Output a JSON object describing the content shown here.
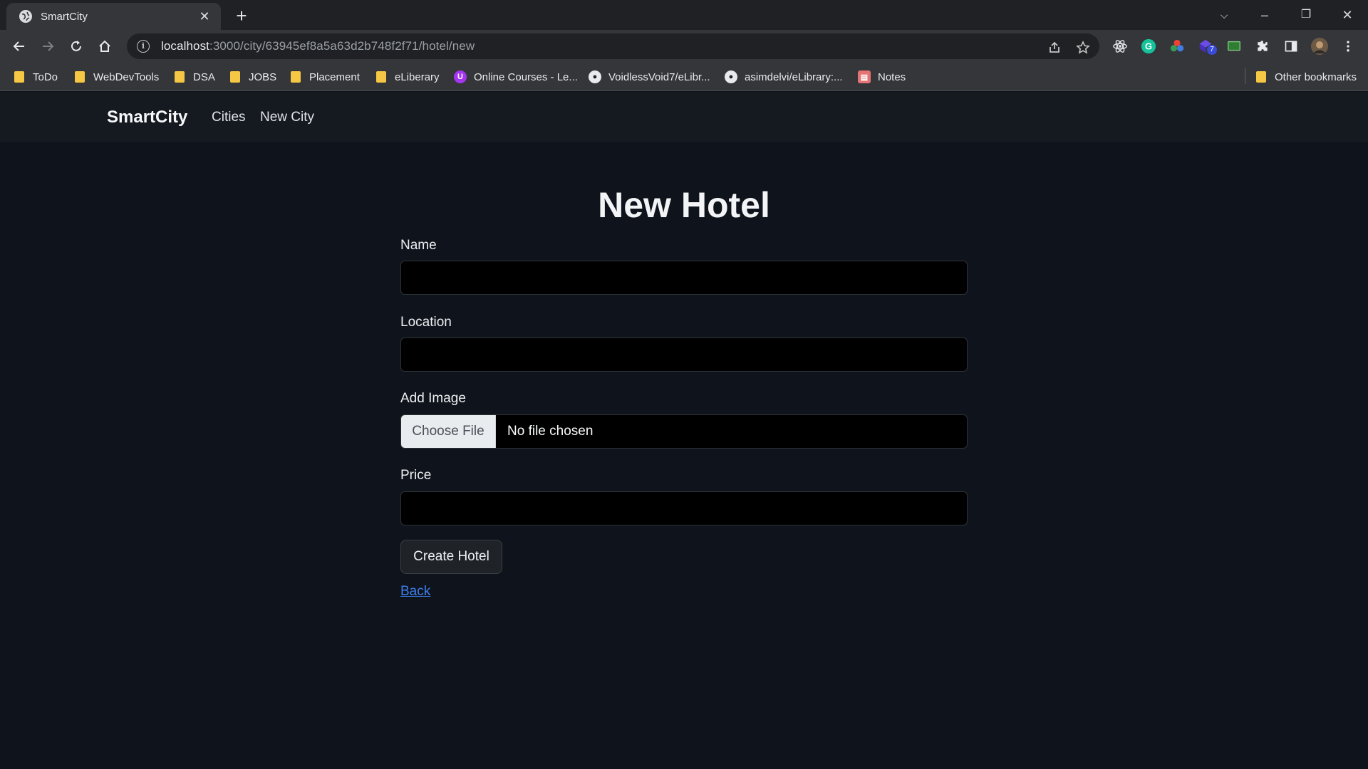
{
  "browser": {
    "tab_title": "SmartCity",
    "url_host": "localhost",
    "url_path": ":3000/city/63945ef8a5a63d2b748f2f71/hotel/new",
    "bookmarks": [
      {
        "label": "ToDo",
        "icon": "folder-icon"
      },
      {
        "label": "WebDevTools",
        "icon": "folder-icon"
      },
      {
        "label": "DSA",
        "icon": "folder-icon"
      },
      {
        "label": "JOBS",
        "icon": "folder-icon"
      },
      {
        "label": "Placement",
        "icon": "folder-icon"
      },
      {
        "label": "eLiberary",
        "icon": "folder-icon"
      },
      {
        "label": "Online Courses - Le...",
        "icon": "udemy-icon"
      },
      {
        "label": "VoidlessVoid7/eLibr...",
        "icon": "github-icon"
      },
      {
        "label": "asimdelvi/eLibrary:...",
        "icon": "github-icon"
      },
      {
        "label": "Notes",
        "icon": "notes-icon"
      }
    ],
    "other_bookmarks": "Other bookmarks",
    "extension_badge": "7"
  },
  "navbar": {
    "brand": "SmartCity",
    "links": [
      "Cities",
      "New City"
    ]
  },
  "form": {
    "title": "New Hotel",
    "name_label": "Name",
    "name_value": "",
    "location_label": "Location",
    "location_value": "",
    "image_label": "Add Image",
    "file_button": "Choose File",
    "file_status": "No file chosen",
    "price_label": "Price",
    "price_value": "",
    "submit_label": "Create Hotel",
    "back_label": "Back"
  },
  "colors": {
    "page_bg": "#0f131b",
    "navbar_bg": "#151920",
    "link": "#3d7ff0"
  }
}
